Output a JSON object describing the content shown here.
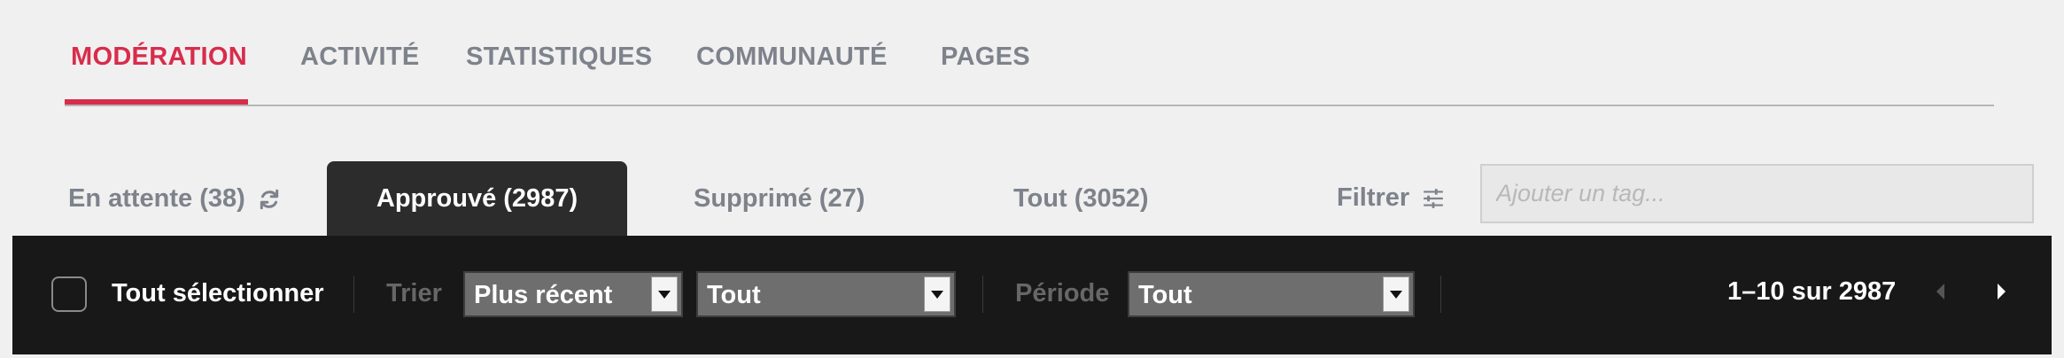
{
  "main_nav": {
    "tabs": [
      {
        "label": "MODÉRATION",
        "active": true
      },
      {
        "label": "ACTIVITÉ",
        "active": false
      },
      {
        "label": "STATISTIQUES",
        "active": false
      },
      {
        "label": "COMMUNAUTÉ",
        "active": false
      },
      {
        "label": "PAGES",
        "active": false
      }
    ]
  },
  "sub_tabs": [
    {
      "label": "En attente (38)",
      "active": false
    },
    {
      "label": "Approuvé (2987)",
      "active": true
    },
    {
      "label": "Supprimé (27)",
      "active": false
    },
    {
      "label": "Tout (3052)",
      "active": false
    }
  ],
  "filter": {
    "label": "Filtrer",
    "tag_placeholder": "Ajouter un tag...",
    "tag_value": ""
  },
  "toolbar": {
    "select_all_label": "Tout sélectionner",
    "select_all_checked": false,
    "sort_label": "Trier",
    "sort_value": "Plus récent",
    "type_value": "Tout",
    "period_label": "Période",
    "period_value": "Tout",
    "pagination_text": "1–10 sur 2987"
  },
  "colors": {
    "accent": "#d82c4c",
    "muted_text": "#7d828b",
    "toolbar_bg": "#181818",
    "active_tab_bg": "#2c2c2c"
  },
  "icons": {
    "refresh": "refresh-icon",
    "filter": "sliders-icon",
    "prev": "chevron-left-icon",
    "next": "chevron-right-icon",
    "dropdown": "triangle-down-icon"
  }
}
